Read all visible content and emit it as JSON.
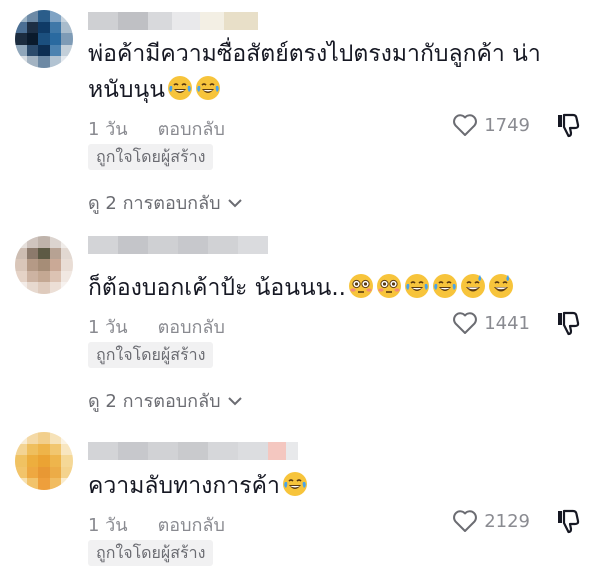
{
  "comments": [
    {
      "text": "พ่อค้ามีความซื่อสัตย์ตรงไปตรงมากับลูกค้า น่าหนับนุน",
      "emojis": [
        "face-with-tears-of-joy",
        "face-with-tears-of-joy"
      ],
      "time": "1 วัน",
      "reply_label": "ตอบกลับ",
      "likes": "1749",
      "badge": "ถูกใจโดยผู้สร้าง",
      "view_replies": "ดู 2 การตอบกลับ"
    },
    {
      "text": "ก็ต้องบอกเค้าป้ะ น้อนนน..",
      "emojis": [
        "flushed-face",
        "flushed-face",
        "face-with-tears-of-joy",
        "face-with-tears-of-joy",
        "grinning-face-with-sweat",
        "grinning-face-with-sweat"
      ],
      "time": "1 วัน",
      "reply_label": "ตอบกลับ",
      "likes": "1441",
      "badge": "ถูกใจโดยผู้สร้าง",
      "view_replies": "ดู 2 การตอบกลับ"
    },
    {
      "text": "ความลับทางการค้า",
      "emojis": [
        "face-with-tears-of-joy"
      ],
      "time": "1 วัน",
      "reply_label": "ตอบกลับ",
      "likes": "2129",
      "badge": "ถูกใจโดยผู้สร้าง"
    }
  ],
  "colors": {
    "text": "#161823",
    "muted": "#8a8b91",
    "badge_bg": "#f1f1f2"
  }
}
